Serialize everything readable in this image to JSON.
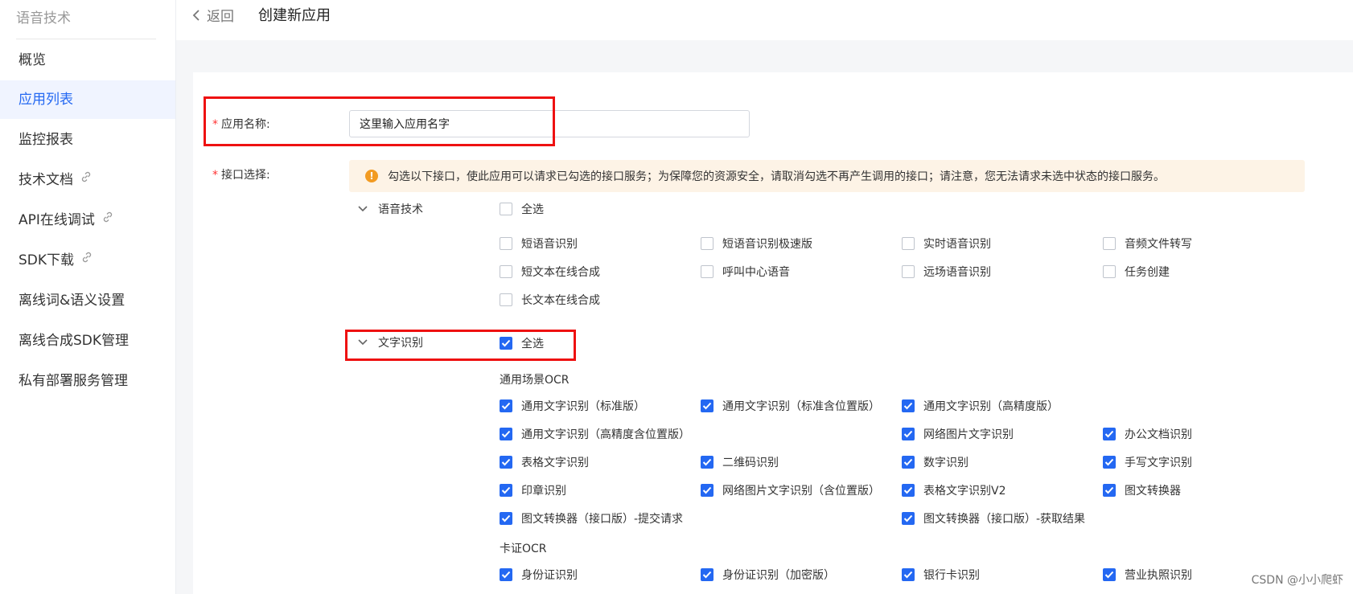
{
  "sidebar": {
    "title": "语音技术",
    "items": [
      {
        "label": "概览",
        "link": false,
        "active": false
      },
      {
        "label": "应用列表",
        "link": false,
        "active": true
      },
      {
        "label": "监控报表",
        "link": false,
        "active": false
      },
      {
        "label": "技术文档",
        "link": true,
        "active": false
      },
      {
        "label": "API在线调试",
        "link": true,
        "active": false
      },
      {
        "label": "SDK下载",
        "link": true,
        "active": false
      },
      {
        "label": "离线词&语义设置",
        "link": false,
        "active": false
      },
      {
        "label": "离线合成SDK管理",
        "link": false,
        "active": false
      },
      {
        "label": "私有部署服务管理",
        "link": false,
        "active": false
      }
    ]
  },
  "header": {
    "back_label": "返回",
    "title": "创建新应用"
  },
  "form": {
    "required_mark": "*",
    "name_label": "应用名称:",
    "name_value": "这里输入应用名字",
    "api_label": "接口选择:",
    "notice": "勾选以下接口，使此应用可以请求已勾选的接口服务；为保障您的资源安全，请取消勾选不再产生调用的接口；请注意，您无法请求未选中状态的接口服务。"
  },
  "groups": [
    {
      "name": "语音技术",
      "select_all_label": "全选",
      "select_all_checked": false,
      "items": [
        {
          "label": "短语音识别",
          "checked": false
        },
        {
          "label": "短语音识别极速版",
          "checked": false
        },
        {
          "label": "实时语音识别",
          "checked": false
        },
        {
          "label": "音频文件转写",
          "checked": false
        },
        {
          "label": "短文本在线合成",
          "checked": false
        },
        {
          "label": "呼叫中心语音",
          "checked": false
        },
        {
          "label": "远场语音识别",
          "checked": false
        },
        {
          "label": "任务创建",
          "checked": false
        },
        {
          "label": "长文本在线合成",
          "checked": false
        }
      ]
    },
    {
      "name": "文字识别",
      "select_all_label": "全选",
      "select_all_checked": true,
      "subgroups": [
        {
          "name": "通用场景OCR",
          "items": [
            {
              "label": "通用文字识别（标准版）",
              "checked": true
            },
            {
              "label": "通用文字识别（标准含位置版）",
              "checked": true
            },
            {
              "label": "通用文字识别（高精度版）",
              "checked": true
            },
            {
              "label": "通用文字识别（高精度含位置版）",
              "checked": true
            },
            {
              "label": "网络图片文字识别",
              "checked": true
            },
            {
              "label": "办公文档识别",
              "checked": true
            },
            {
              "label": "表格文字识别",
              "checked": true
            },
            {
              "label": "二维码识别",
              "checked": true
            },
            {
              "label": "数字识别",
              "checked": true
            },
            {
              "label": "手写文字识别",
              "checked": true
            },
            {
              "label": "印章识别",
              "checked": true
            },
            {
              "label": "网络图片文字识别（含位置版）",
              "checked": true
            },
            {
              "label": "表格文字识别V2",
              "checked": true
            },
            {
              "label": "图文转换器",
              "checked": true
            },
            {
              "label": "图文转换器（接口版）-提交请求",
              "checked": true
            },
            {
              "label": "图文转换器（接口版）-获取结果",
              "checked": true
            }
          ]
        },
        {
          "name": "卡证OCR",
          "items": [
            {
              "label": "身份证识别",
              "checked": true
            },
            {
              "label": "身份证识别（加密版）",
              "checked": true
            },
            {
              "label": "银行卡识别",
              "checked": true
            },
            {
              "label": "营业执照识别",
              "checked": true
            }
          ]
        }
      ]
    }
  ],
  "watermark": "CSDN @小小爬虾",
  "colors": {
    "accent": "#2468f2",
    "highlight": "#ee1111",
    "notice_bg": "#fdf3e6",
    "notice_icon": "#f29b22"
  }
}
